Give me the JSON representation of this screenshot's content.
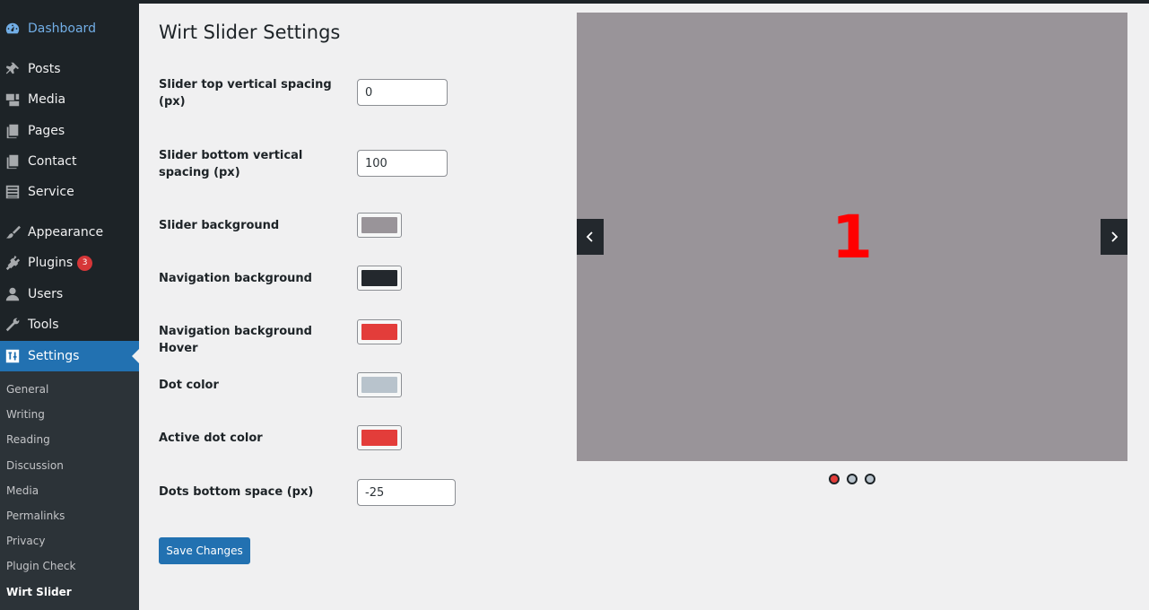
{
  "sidebar": {
    "dashboard": "Dashboard",
    "items": [
      {
        "label": "Posts",
        "icon": "pin-icon"
      },
      {
        "label": "Media",
        "icon": "media-icon"
      },
      {
        "label": "Pages",
        "icon": "pages-icon"
      },
      {
        "label": "Contact",
        "icon": "pages-icon"
      },
      {
        "label": "Service",
        "icon": "list-icon"
      },
      {
        "label": "Appearance",
        "icon": "brush-icon"
      },
      {
        "label": "Plugins",
        "icon": "plug-icon",
        "badge": "3"
      },
      {
        "label": "Users",
        "icon": "user-icon"
      },
      {
        "label": "Tools",
        "icon": "wrench-icon"
      },
      {
        "label": "Settings",
        "icon": "settings-icon",
        "active": true
      }
    ],
    "submenu": [
      "General",
      "Writing",
      "Reading",
      "Discussion",
      "Media",
      "Permalinks",
      "Privacy",
      "Plugin Check",
      "Wirt Slider"
    ],
    "submenu_current": "Wirt Slider"
  },
  "page": {
    "title": "Wirt Slider Settings",
    "fields": {
      "top_spacing": {
        "label": "Slider top vertical spacing (px)",
        "value": "0"
      },
      "bottom_spacing": {
        "label": "Slider bottom vertical spacing (px)",
        "value": "100"
      },
      "slider_bg": {
        "label": "Slider background",
        "color": "#999499"
      },
      "nav_bg": {
        "label": "Navigation background",
        "color": "#23282d"
      },
      "nav_bg_hover": {
        "label": "Navigation background Hover",
        "color": "#e33d3a"
      },
      "dot_color": {
        "label": "Dot color",
        "color": "#b8c3cc"
      },
      "active_dot_color": {
        "label": "Active dot color",
        "color": "#e33d3a"
      },
      "dots_bottom_space": {
        "label": "Dots bottom space (px)",
        "value": "-25"
      }
    },
    "save_label": "Save Changes"
  },
  "preview": {
    "slide_text": "1",
    "slide_text_color": "#ff0000",
    "dots_count": 3,
    "active_dot": 0
  },
  "colors": {
    "sidebar_bg": "#1d2327",
    "submenu_bg": "#2c3338",
    "accent": "#2271b1"
  }
}
